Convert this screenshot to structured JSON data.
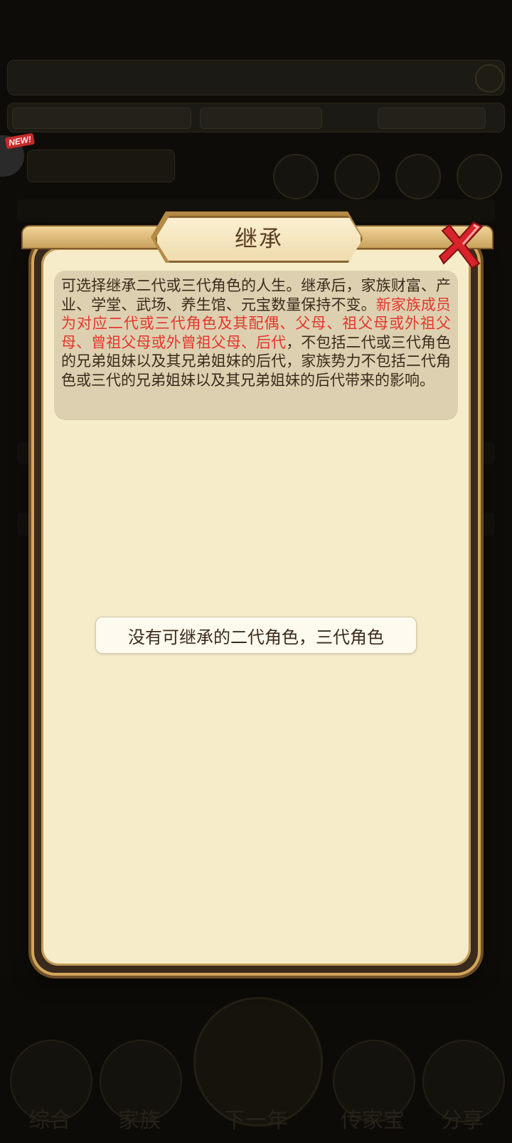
{
  "background": {
    "new_badge": "NEW!",
    "bottom_nav": [
      "综合",
      "家族",
      "下一年",
      "传家宝",
      "分享"
    ]
  },
  "dialog": {
    "title": "继承",
    "description_part1": "可选择继承二代或三代角色的人生。继承后，家族财富、产业、学堂、武场、养生馆、元宝数量保持不变。",
    "description_highlight": "新家族成员为对应二代或三代角色及其配偶、父母、祖父母或外祖父母、曾祖父母或外曾祖父母、后代",
    "description_part2": "，不包括二代或三代角色的兄弟姐妹以及其兄弟姐妹的后代，家族势力不包括二代角色或三代的兄弟姐妹以及其兄弟姐妹的后代带来的影响。",
    "empty_message": "没有可继承的二代角色，三代角色",
    "close_icon": "close-x-icon"
  },
  "colors": {
    "highlight": "#e3382c",
    "panel": "#f6ecca",
    "description_bg": "#ddd0b1",
    "close_red": "#d8232a"
  }
}
